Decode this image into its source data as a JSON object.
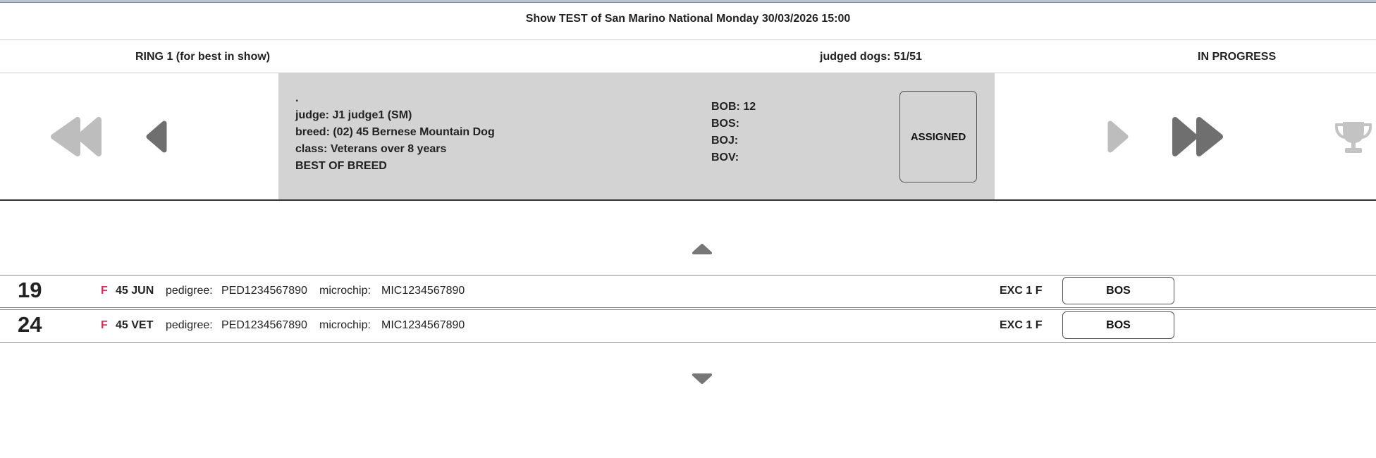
{
  "header": {
    "title": "Show TEST of San Marino National Monday 30/03/2026 15:00",
    "ring": "RING 1 (for best in show)",
    "judged": "judged dogs: 51/51",
    "status": "IN PROGRESS"
  },
  "info": {
    "dot": ".",
    "judge": "judge: J1 judge1 (SM)",
    "breed": "breed: (02) 45 Bernese Mountain Dog",
    "class": "class: Veterans over 8 years",
    "section": "BEST OF BREED",
    "bob": "BOB: 12",
    "bos": "BOS:",
    "boj": "BOJ:",
    "bov": "BOV:",
    "assigned_label": "ASSIGNED"
  },
  "icons": {
    "first": "double-chevron-left-icon",
    "prev": "chevron-left-icon",
    "next": "chevron-right-icon",
    "last": "double-chevron-right-icon",
    "trophy": "trophy-icon",
    "scroll_up": "caret-up-icon",
    "scroll_down": "caret-down-icon"
  },
  "dogs": [
    {
      "number": "19",
      "sex": "F",
      "class": "45 JUN",
      "pedigree_label": "pedigree:",
      "pedigree": "PED1234567890",
      "microchip_label": "microchip:",
      "microchip": "MIC1234567890",
      "grade": "EXC 1 F",
      "award": "BOS"
    },
    {
      "number": "24",
      "sex": "F",
      "class": "45 VET",
      "pedigree_label": "pedigree:",
      "pedigree": "PED1234567890",
      "microchip_label": "microchip:",
      "microchip": "MIC1234567890",
      "grade": "EXC 1 F",
      "award": "BOS"
    }
  ],
  "colors": {
    "panel": "#d3d3d3",
    "sex_female": "#d1305a",
    "icon_dark": "#6f6f6f",
    "icon_light": "#bdbdbd"
  }
}
